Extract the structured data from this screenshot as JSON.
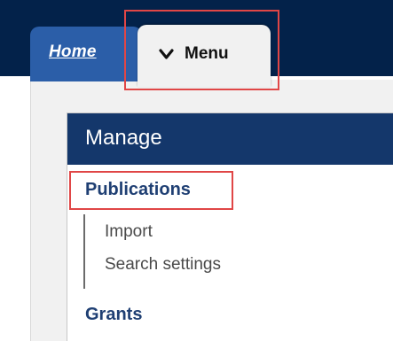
{
  "tabs": {
    "home_label": "Home",
    "menu_label": "Menu",
    "menu_icon": "chevron-down-icon"
  },
  "menu": {
    "header": "Manage",
    "items": [
      {
        "label": "Publications",
        "highlighted": true,
        "subitems": [
          {
            "label": "Import"
          },
          {
            "label": "Search settings"
          }
        ]
      },
      {
        "label": "Grants"
      }
    ]
  },
  "colors": {
    "toolbar": "#03224a",
    "home_tab": "#2b5ea8",
    "menu_header": "#14376b",
    "menu_item_text": "#1f3f73",
    "highlight": "#e04646",
    "tray": "#f1f1f1"
  }
}
